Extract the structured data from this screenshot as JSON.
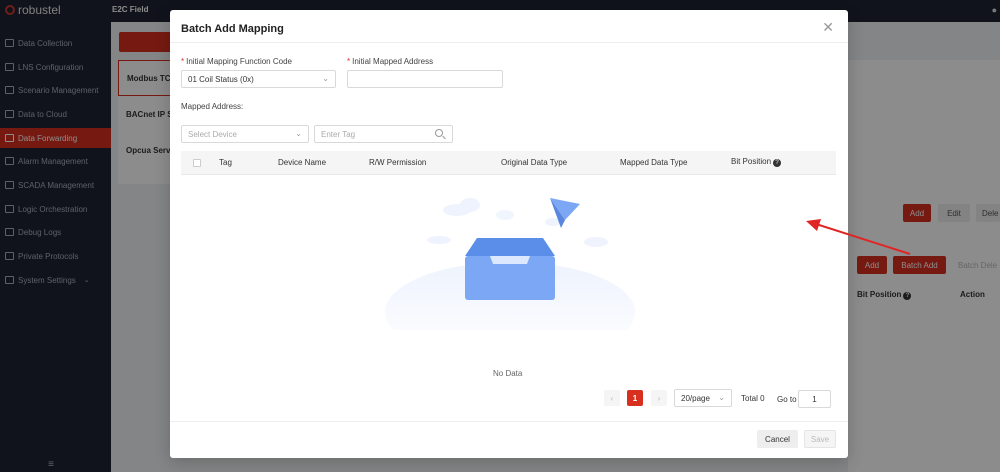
{
  "app": {
    "logo_text": "robustel",
    "top_tab": "E2C Field"
  },
  "sidebar": {
    "items": [
      {
        "label": "Data Collection",
        "icon": "grid-icon"
      },
      {
        "label": "LNS Configuration",
        "icon": "monitor-icon"
      },
      {
        "label": "Scenario Management",
        "icon": "layers-icon"
      },
      {
        "label": "Data to Cloud",
        "icon": "cloud-icon"
      },
      {
        "label": "Data Forwarding",
        "icon": "forward-icon",
        "active": true
      },
      {
        "label": "Alarm Management",
        "icon": "bell-icon"
      },
      {
        "label": "SCADA Management",
        "icon": "screen-icon"
      },
      {
        "label": "Logic Orchestration",
        "icon": "flow-icon"
      },
      {
        "label": "Debug Logs",
        "icon": "log-icon"
      },
      {
        "label": "Private Protocols",
        "icon": "diamond-icon"
      },
      {
        "label": "System Settings",
        "icon": "gear-icon"
      }
    ]
  },
  "background": {
    "protocols": [
      "Modbus TCP",
      "BACnet IP S",
      "Opcua Serv"
    ],
    "upper_buttons": {
      "add": "Add",
      "edit": "Edit",
      "delete": "Dele"
    },
    "lower_buttons": {
      "add": "Add",
      "batch_add": "Batch Add",
      "batch_delete": "Batch Dele"
    },
    "table_headers": {
      "bit_position": "Bit Position",
      "action": "Action"
    }
  },
  "modal": {
    "title": "Batch Add Mapping",
    "function_code_label": "Initial Mapping Function Code",
    "function_code_value": "01 Coil Status (0x)",
    "mapped_address_label": "Initial Mapped Address",
    "mapped_address_value": "",
    "mapped_address_section": "Mapped Address:",
    "device_select_placeholder": "Select Device",
    "tag_placeholder": "Enter Tag",
    "table_headers": {
      "tag": "Tag",
      "device_name": "Device Name",
      "rw_permission": "R/W Permission",
      "original_data_type": "Original Data Type",
      "mapped_data_type": "Mapped Data Type",
      "bit_position": "Bit Position"
    },
    "empty_text": "No Data",
    "pagination": {
      "current_page": "1",
      "page_size": "20/page",
      "total": "Total 0",
      "goto_label": "Go to",
      "goto_value": "1"
    },
    "cancel_label": "Cancel",
    "save_label": "Save"
  },
  "colors": {
    "accent": "#d8301f",
    "sidebar_bg": "#1f2433",
    "empty_box": "#7ba7f5"
  }
}
